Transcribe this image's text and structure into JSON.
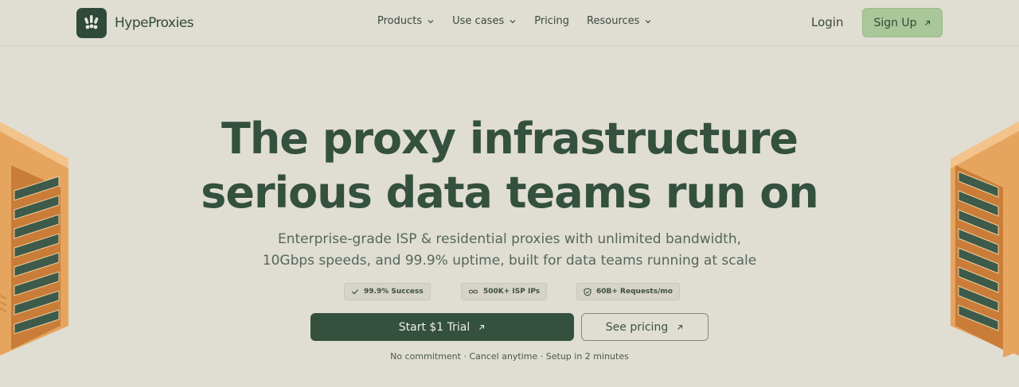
{
  "brand": {
    "name": "HypeProxies"
  },
  "nav": {
    "items": [
      {
        "label": "Products",
        "has_dropdown": true
      },
      {
        "label": "Use cases",
        "has_dropdown": true
      },
      {
        "label": "Pricing",
        "has_dropdown": false
      },
      {
        "label": "Resources",
        "has_dropdown": true
      }
    ],
    "login_label": "Login",
    "signup_label": "Sign Up"
  },
  "hero": {
    "headline_line1": "The proxy infrastructure",
    "headline_line2": "serious data teams run on",
    "subtitle_line1": "Enterprise-grade ISP & residential proxies with unlimited bandwidth,",
    "subtitle_line2": "10Gbps speeds, and 99.9% uptime, built for data teams running at scale",
    "badges": [
      {
        "icon": "check-icon",
        "label": "99.9% Success"
      },
      {
        "icon": "infinity-icon",
        "label": "500K+ ISP IPs"
      },
      {
        "icon": "shield-icon",
        "label": "60B+ Requests/mo"
      }
    ],
    "primary_cta": "Start $1 Trial",
    "secondary_cta": "See pricing",
    "note": "No commitment · Cancel anytime · Setup in 2 minutes"
  },
  "colors": {
    "background": "#e0ddd3",
    "primary": "#34503e",
    "signup_accent": "#a9c798",
    "rack": "#e8a85f"
  }
}
